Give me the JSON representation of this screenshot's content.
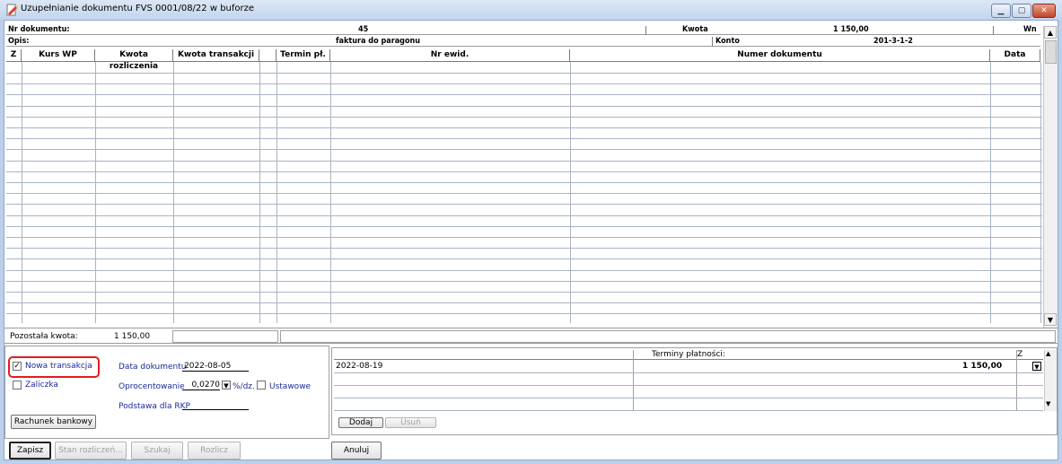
{
  "window": {
    "title": "Uzupełnianie dokumentu FVS 0001/08/22 w buforze"
  },
  "header": {
    "nr_dokumentu_label": "Nr dokumentu:",
    "nr_dokumentu_value": "45",
    "kwota_label": "Kwota",
    "kwota_value": "1 150,00",
    "wn_label": "Wn",
    "opis_label": "Opis:",
    "opis_value": "faktura do paragonu",
    "konto_label": "Konto",
    "konto_value": "201-3-1-2"
  },
  "table": {
    "columns": [
      "Z",
      "Kurs WP",
      "Kwota rozliczenia",
      "Kwota transakcji",
      "",
      "Termin pł.",
      "Nr ewid.",
      "Numer dokumentu",
      "Data"
    ],
    "rows": []
  },
  "status": {
    "pozostala_label": "Pozostała kwota:",
    "pozostala_value": "1 150,00"
  },
  "options": {
    "nowa_transakcja_label": "Nowa transakcja",
    "nowa_transakcja_checked": true,
    "zaliczka_label": "Zaliczka",
    "zaliczka_checked": false,
    "data_dokumentu_label": "Data dokumentu",
    "data_dokumentu_value": "2022-08-05",
    "oprocentowanie_label": "Oprocentowanie",
    "oprocentowanie_value": "0,0270",
    "oprocentowanie_unit": "%/dz.",
    "ustawowe_label": "Ustawowe",
    "ustawowe_checked": false,
    "podstawa_label": "Podstawa dla RKP",
    "rachunek_button": "Rachunek bankowy"
  },
  "terminy": {
    "header": "Terminy płatności:",
    "z_header": "Z",
    "rows": [
      {
        "date": "2022-08-19",
        "amount": "1 150,00"
      }
    ],
    "dodaj_button": "Dodaj",
    "usun_button": "Usuń"
  },
  "footer": {
    "zapisz": "Zapisz",
    "stan_rozliczen": "Stan rozliczeń...",
    "szukaj": "Szukaj",
    "rozlicz": "Rozlicz",
    "anuluj": "Anuluj"
  },
  "colors": {
    "highlight": "#e11d1d",
    "titlebar": "#c2d5ee",
    "label_blue": "#1a2a9a"
  }
}
